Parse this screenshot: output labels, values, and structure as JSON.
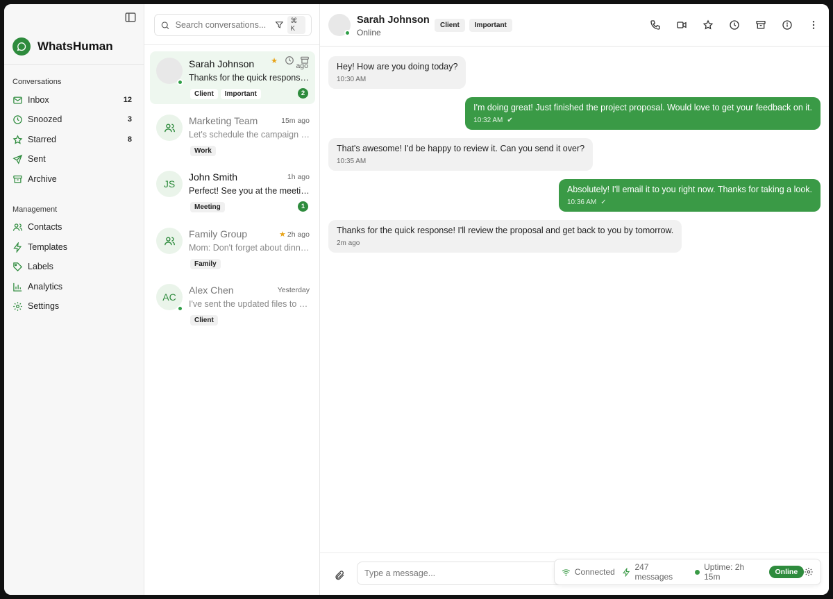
{
  "app": {
    "name": "WhatsHuman"
  },
  "sidebar": {
    "conversations_heading": "Conversations",
    "management_heading": "Management",
    "items": [
      {
        "label": "Inbox",
        "count": "12",
        "icon": "inbox-icon"
      },
      {
        "label": "Snoozed",
        "count": "3",
        "icon": "clock-icon"
      },
      {
        "label": "Starred",
        "count": "8",
        "icon": "star-icon"
      },
      {
        "label": "Sent",
        "count": "",
        "icon": "send-icon"
      },
      {
        "label": "Archive",
        "count": "",
        "icon": "archive-icon"
      }
    ],
    "management_items": [
      {
        "label": "Contacts",
        "icon": "users-icon"
      },
      {
        "label": "Templates",
        "icon": "zap-icon"
      },
      {
        "label": "Labels",
        "icon": "tag-icon"
      },
      {
        "label": "Analytics",
        "icon": "bar-chart-icon"
      },
      {
        "label": "Settings",
        "icon": "gear-icon"
      }
    ]
  },
  "search": {
    "placeholder": "Search conversations...",
    "shortcut": "⌘ K"
  },
  "conversations": [
    {
      "name": "Sarah Johnson",
      "time": "ago",
      "preview": "Thanks for the quick response! I'll review the proposal",
      "tags": [
        "Client",
        "Important"
      ],
      "unread": "2"
    },
    {
      "name": "Marketing Team",
      "time": "15m ago",
      "preview": "Let's schedule the campaign review",
      "tags": [
        "Work"
      ],
      "unread": ""
    },
    {
      "name": "John Smith",
      "initials": "JS",
      "time": "1h ago",
      "preview": "Perfect! See you at the meeting tomorrow",
      "tags": [
        "Meeting"
      ],
      "unread": "1"
    },
    {
      "name": "Family Group",
      "time": "2h ago",
      "preview": "Mom: Don't forget about dinner tonight",
      "tags": [
        "Family"
      ],
      "unread": ""
    },
    {
      "name": "Alex Chen",
      "initials": "AC",
      "time": "Yesterday",
      "preview": "I've sent the updated files to your email",
      "tags": [
        "Client"
      ],
      "unread": ""
    }
  ],
  "chat": {
    "contact_name": "Sarah Johnson",
    "status": "Online",
    "tags": [
      "Client",
      "Important"
    ],
    "messages": [
      {
        "dir": "in",
        "text": "Hey! How are you doing today?",
        "time": "10:30 AM"
      },
      {
        "dir": "out",
        "text": "I'm doing great! Just finished the project proposal. Would love to get your feedback on it.",
        "time": "10:32 AM"
      },
      {
        "dir": "in",
        "text": "That's awesome! I'd be happy to review it. Can you send it over?",
        "time": "10:35 AM"
      },
      {
        "dir": "out",
        "text": "Absolutely! I'll email it to you right now. Thanks for taking a look.",
        "time": "10:36 AM"
      },
      {
        "dir": "in",
        "text": "Thanks for the quick response! I'll review the proposal and get back to you by tomorrow.",
        "time": "2m ago"
      }
    ],
    "composer_placeholder": "Type a message..."
  },
  "statusbar": {
    "connection": "Connected",
    "messages": "247 messages",
    "uptime": "Uptime: 2h 15m",
    "status": "Online"
  },
  "colors": {
    "accent": "#2e8b3d",
    "bubble_out": "#3a9a46",
    "bubble_in": "#f1f1f1",
    "star": "#e8a317"
  }
}
